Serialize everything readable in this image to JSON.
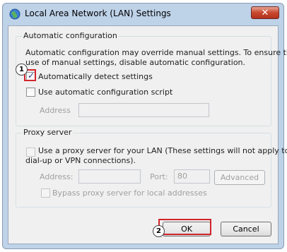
{
  "window": {
    "title": "Local Area Network (LAN) Settings",
    "close_label": "✕",
    "icon": "network-globe-icon"
  },
  "automatic": {
    "group_title": "Automatic configuration",
    "description_line1": "Automatic configuration may override manual settings.  To ensure the",
    "description_line2": "use of manual settings, disable automatic configuration.",
    "detect_label": "Automatically detect settings",
    "detect_checked": true,
    "script_label": "Use automatic configuration script",
    "script_checked": false,
    "address_label": "Address",
    "address_value": ""
  },
  "proxy": {
    "group_title": "Proxy server",
    "use_proxy_line1": "Use a proxy server for your LAN (These settings will not apply to",
    "use_proxy_line2": "dial-up or VPN connections).",
    "use_proxy_checked": false,
    "address_label": "Address:",
    "address_value": "",
    "port_label": "Port:",
    "port_value": "80",
    "advanced_label": "Advanced",
    "bypass_label": "Bypass proxy server for local addresses",
    "bypass_checked": false
  },
  "footer": {
    "ok_label": "OK",
    "cancel_label": "Cancel"
  },
  "annotations": {
    "badge1": "1",
    "badge2": "2",
    "highlight_color": "#d2242b"
  }
}
